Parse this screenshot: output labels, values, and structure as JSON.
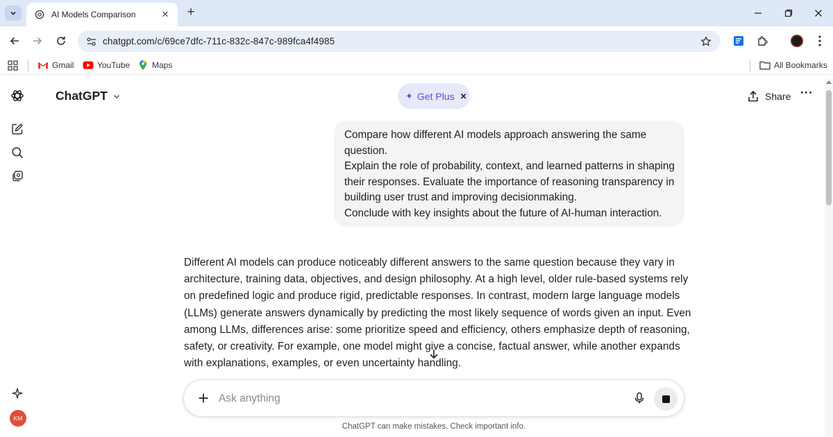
{
  "browser": {
    "tab": {
      "title": "AI Models Comparison",
      "close_glyph": "✕",
      "favicon": "chatgpt-logo-icon"
    },
    "new_tab_glyph": "+",
    "url": "chatgpt.com/c/69ce7dfc-711c-832c-847c-989fca4f4985",
    "bookmarks": [
      {
        "label": "Gmail",
        "icon": "gmail-icon"
      },
      {
        "label": "YouTube",
        "icon": "youtube-icon"
      },
      {
        "label": "Maps",
        "icon": "maps-icon"
      }
    ],
    "all_bookmarks": "All Bookmarks"
  },
  "header": {
    "title": "ChatGPT",
    "get_plus": {
      "label": "Get Plus",
      "spark": "✦",
      "close": "✕"
    },
    "share_label": "Share",
    "more_glyph": "···"
  },
  "conversation": {
    "user_message": [
      "Compare how different AI models approach answering the same",
      "question.",
      "Explain the role of probability, context, and learned patterns in shaping",
      "their responses. Evaluate the importance of reasoning transparency in",
      "building user trust and improving decisionmaking.",
      "Conclude with key insights about the future of AI-human interaction."
    ],
    "assistant_message": [
      "Different AI models can produce noticeably different answers to the same question because they vary in",
      "architecture, training data, objectives, and design philosophy. At a high level, older rule-based systems rely",
      "on predefined logic and produce rigid, predictable responses. In contrast, modern large language models",
      "(LLMs) generate answers dynamically by predicting the most likely sequence of words given an input. Even",
      "among LLMs, differences arise: some prioritize speed and efficiency, others emphasize depth of reasoning,",
      "safety, or creativity. For example, one model might give a concise, factual answer, while another expands",
      "with explanations, examples, or even uncertainty handling."
    ]
  },
  "composer": {
    "placeholder": "Ask anything"
  },
  "footer": {
    "disclaimer": "ChatGPT can make mistakes. Check important info."
  },
  "user": {
    "initials": "KM",
    "avatar_color": "#e34d35"
  },
  "colors": {
    "accent": "#5b4fd6",
    "tabbar": "#dfe8f6",
    "bubble": "#f4f4f4"
  }
}
